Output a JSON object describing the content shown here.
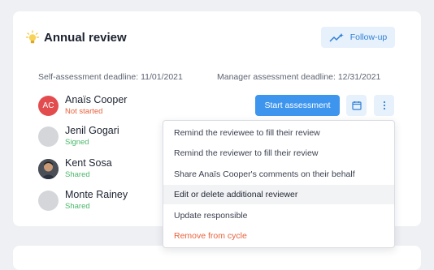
{
  "card": {
    "title": "Annual review",
    "title_icon": "lightbulb-icon",
    "follow_up_label": "Follow-up",
    "self_deadline": "Self-assessment deadline: 11/01/2021",
    "manager_deadline": "Manager assessment deadline: 12/31/2021"
  },
  "people": [
    {
      "name": "Anaïs Cooper",
      "status": "Not started",
      "initials": "AC",
      "status_color": "#e8613c"
    },
    {
      "name": "Jenil Gogari",
      "status": "Signed",
      "status_color": "#4bb86b"
    },
    {
      "name": "Kent Sosa",
      "status": "Shared",
      "status_color": "#4bb86b"
    },
    {
      "name": "Monte Rainey",
      "status": "Shared",
      "status_color": "#4bb86b"
    }
  ],
  "actions": {
    "start_label": "Start assessment",
    "calendar_icon": "calendar-icon",
    "more_icon": "more-vertical-icon"
  },
  "menu": {
    "items": [
      "Remind the reviewee to fill their review",
      "Remind the reviewer to fill their review",
      "Share Anaïs Cooper's comments on their behalf",
      "Edit or delete additional reviewer",
      "Update responsible",
      "Remove from cycle"
    ],
    "highlighted": "Edit or delete additional reviewer",
    "danger_item": "Remove from cycle"
  },
  "colors": {
    "accent": "#3d95ee",
    "danger": "#e8613c",
    "success": "#4bb86b"
  }
}
